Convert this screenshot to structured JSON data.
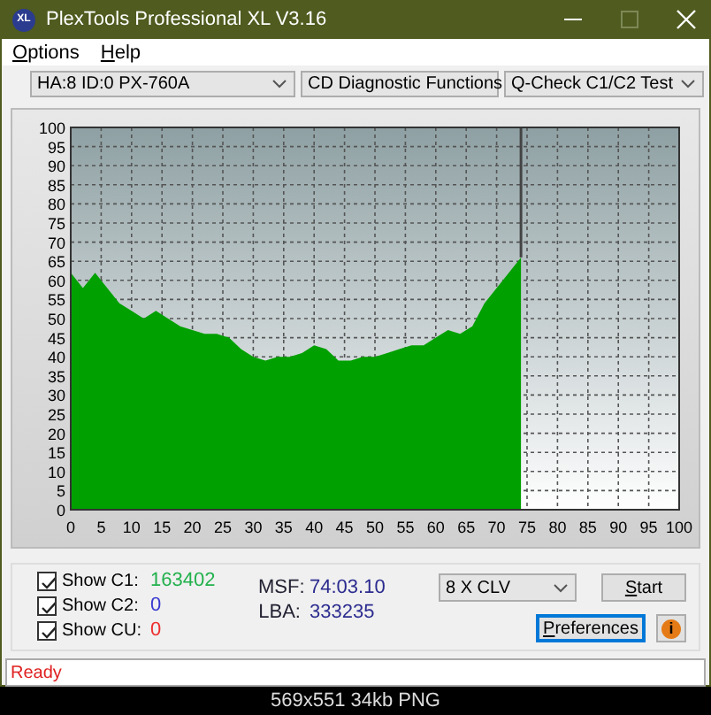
{
  "window": {
    "title": "PlexTools Professional XL V3.16",
    "icon_text": "XL"
  },
  "menu": [
    {
      "label": "Options"
    },
    {
      "label": "Help"
    }
  ],
  "selectors": [
    {
      "value": "HA:8 ID:0  PX-760A"
    },
    {
      "value": "CD Diagnostic Functions"
    },
    {
      "value": "Q-Check C1/C2 Test"
    }
  ],
  "chart": {
    "chart_data": {
      "type": "area",
      "xlim": [
        0,
        100
      ],
      "ylim": [
        0,
        100
      ],
      "xticks": [
        0,
        5,
        10,
        15,
        20,
        25,
        30,
        35,
        40,
        45,
        50,
        55,
        60,
        65,
        70,
        75,
        80,
        85,
        90,
        95,
        100
      ],
      "yticks": [
        0,
        5,
        10,
        15,
        20,
        25,
        30,
        35,
        40,
        45,
        50,
        55,
        60,
        65,
        70,
        75,
        80,
        85,
        90,
        95,
        100
      ],
      "x": [
        0,
        2,
        4,
        6,
        8,
        10,
        12,
        14,
        16,
        18,
        20,
        22,
        24,
        26,
        28,
        30,
        32,
        34,
        36,
        38,
        40,
        42,
        44,
        46,
        48,
        50,
        52,
        54,
        56,
        58,
        60,
        62,
        64,
        66,
        68,
        70,
        72,
        74
      ],
      "grid": true,
      "ref_lines": [
        {
          "axis": "x",
          "value": 74
        }
      ],
      "series": [
        {
          "color": "#00a000",
          "values": [
            62,
            58,
            62,
            58,
            54,
            52,
            50,
            52,
            50,
            48,
            47,
            46,
            46,
            45,
            42,
            40,
            39,
            40,
            40,
            41,
            43,
            42,
            39,
            39,
            40,
            40,
            41,
            42,
            43,
            43,
            45,
            47,
            46,
            48,
            54,
            58,
            62,
            66
          ]
        }
      ]
    }
  },
  "counters": [
    {
      "label": "Show C1:",
      "checked": true,
      "value": "163402",
      "color": "#22b14c"
    },
    {
      "label": "Show C2:",
      "checked": true,
      "value": "0",
      "color": "#3a3ad0"
    },
    {
      "label": "Show CU:",
      "checked": true,
      "value": "0",
      "color": "#ee3030"
    }
  ],
  "position": [
    {
      "label": "MSF:",
      "value": "74:03.10"
    },
    {
      "label": "LBA:",
      "value": "333235"
    }
  ],
  "speed": {
    "value": "8 X CLV"
  },
  "buttons": [
    {
      "label": "Start",
      "focused": false
    },
    {
      "label": "Preferences",
      "focused": true
    }
  ],
  "info_button": {
    "icon_text": "i"
  },
  "status": "Ready",
  "image_caption": "569x551 34kb PNG"
}
